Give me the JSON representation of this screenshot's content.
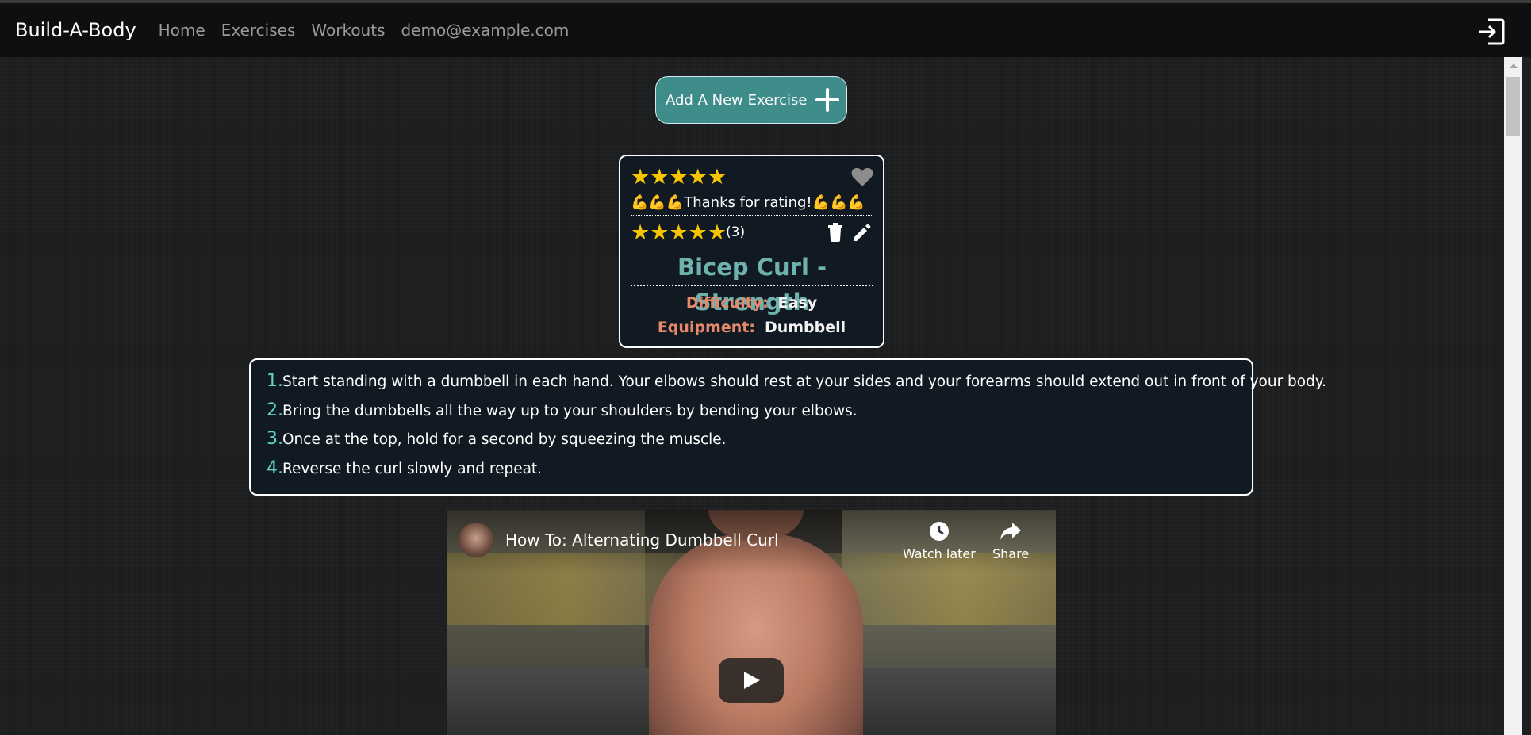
{
  "navbar": {
    "brand": "Build-A-Body",
    "links": [
      "Home",
      "Exercises",
      "Workouts"
    ],
    "user_email": "demo@example.com",
    "logout_icon": "logout-icon"
  },
  "add_button": {
    "label": "Add A New Exercise",
    "icon": "plus-icon"
  },
  "exercise_card": {
    "rating_input": "★★★★★",
    "favorite_icon": "heart-icon",
    "rating_message": "💪💪💪Thanks for rating!💪💪💪",
    "average_rating": 5,
    "average_stars": "★★★★★",
    "rating_count": "(3)",
    "delete_icon": "trash-icon",
    "edit_icon": "pencil-icon",
    "title": "Bicep Curl - Strength",
    "difficulty_label": "Difficulty:",
    "difficulty_value": "Easy",
    "equipment_label": "Equipment:",
    "equipment_value": "Dumbbell"
  },
  "instructions": [
    {
      "num": "1.",
      "text": "Start standing with a dumbbell in each hand. Your elbows should rest at your sides and your forearms should extend out in front of your body."
    },
    {
      "num": "2.",
      "text": "Bring the dumbbells all the way up to your shoulders by bending your elbows."
    },
    {
      "num": "3.",
      "text": "Once at the top, hold for a second by squeezing the muscle."
    },
    {
      "num": "4.",
      "text": "Reverse the curl slowly and repeat."
    }
  ],
  "video": {
    "title": "How To: Alternating Dumbbell Curl",
    "watch_later": "Watch later",
    "share": "Share"
  },
  "colors": {
    "accent_teal": "#3f8d8b",
    "title_teal": "#6fb2ad",
    "label_orange": "#e5896a",
    "star_gold": "#f6c400",
    "step_number": "#5ed4bf"
  }
}
